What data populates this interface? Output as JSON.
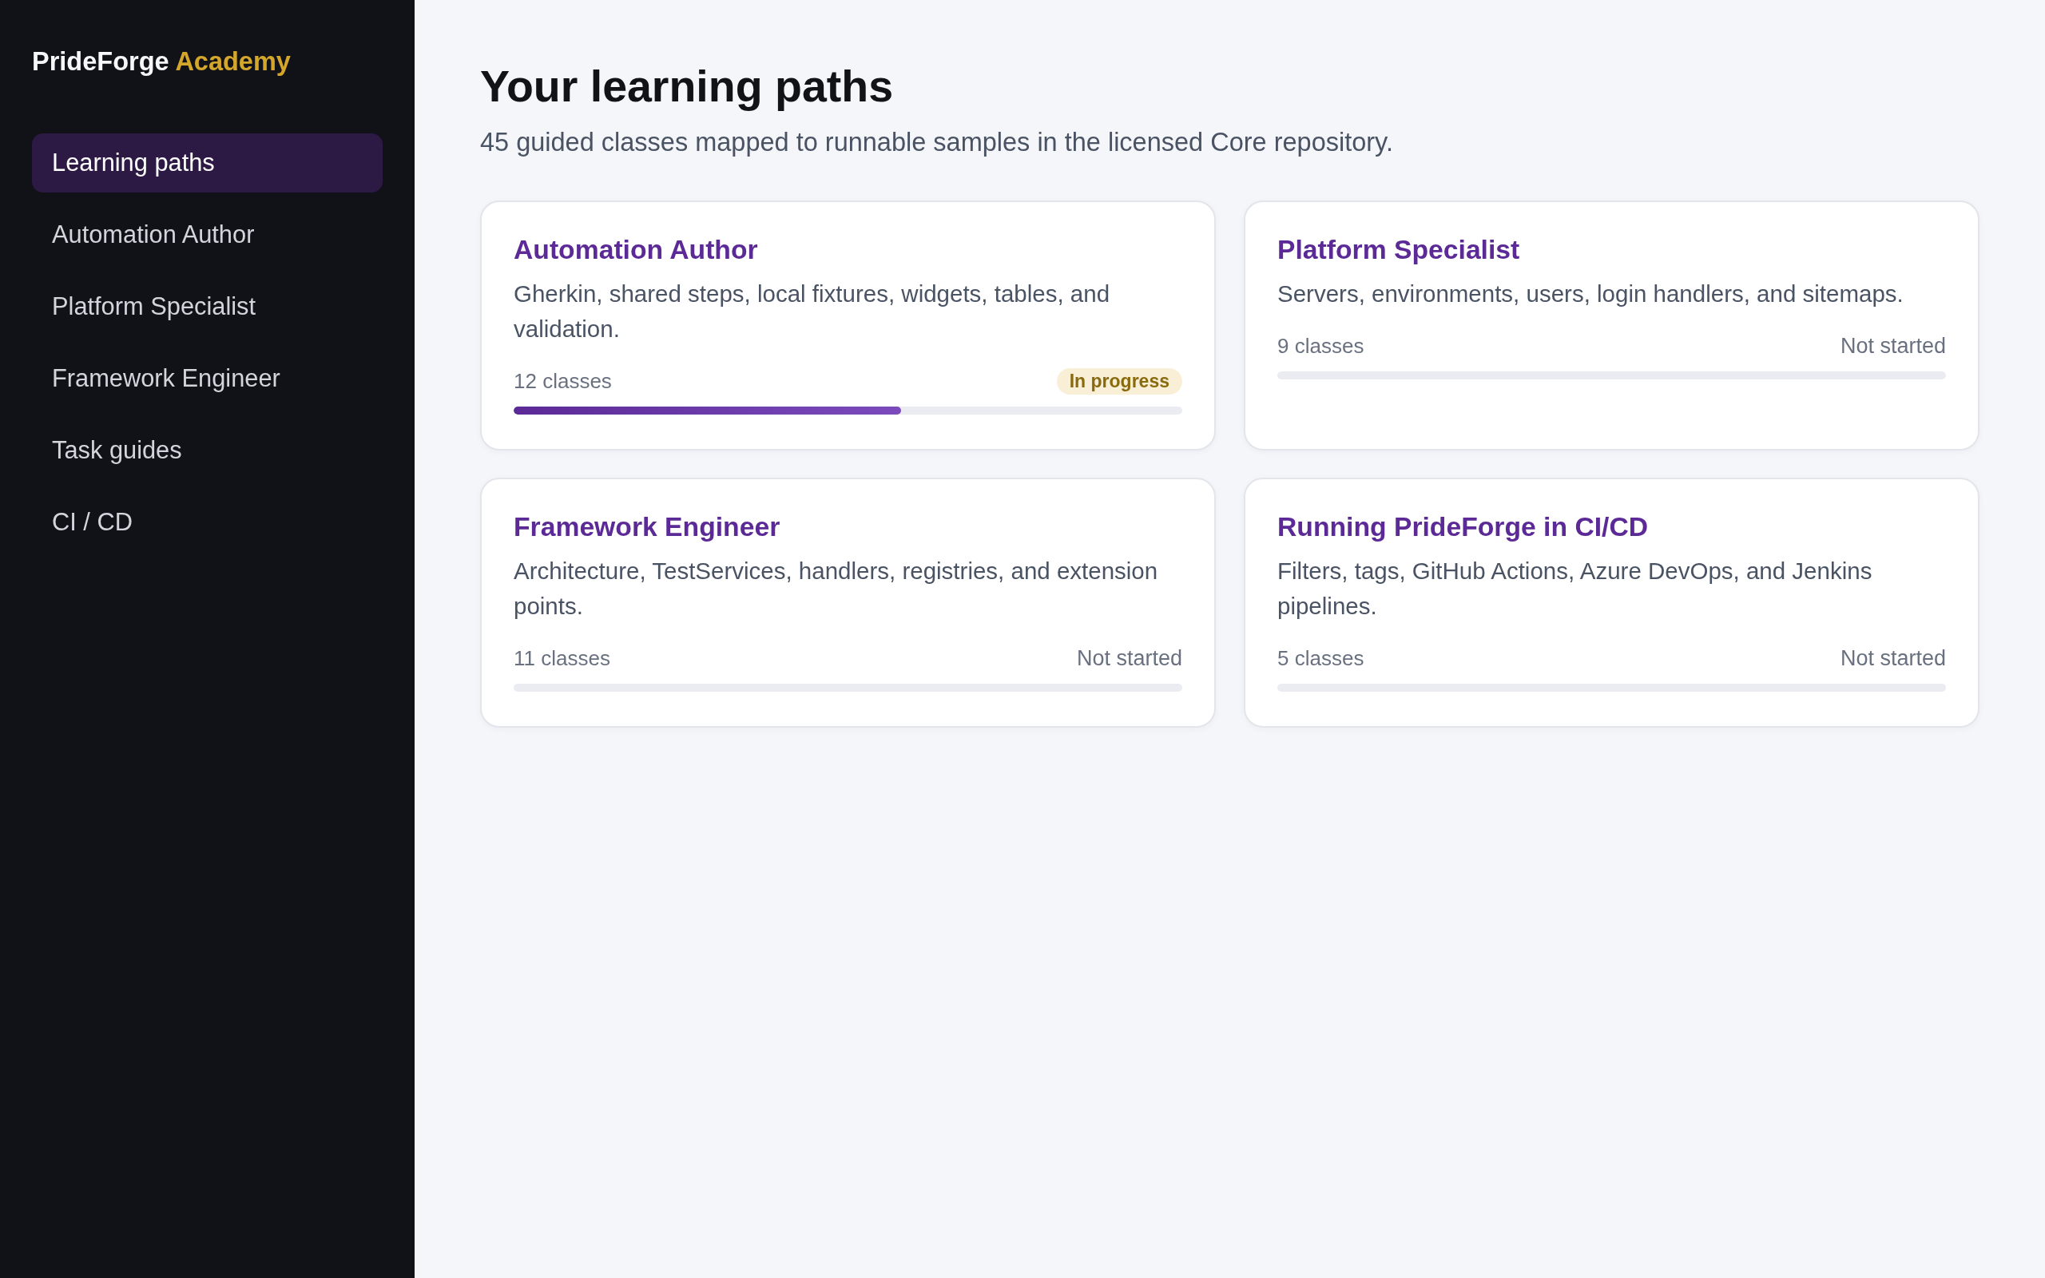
{
  "sidebar": {
    "brand": {
      "name": "PrideForge",
      "accent": "Academy"
    },
    "items": [
      {
        "label": "Learning paths",
        "selected": true
      },
      {
        "label": "Automation Author",
        "selected": false
      },
      {
        "label": "Platform Specialist",
        "selected": false
      },
      {
        "label": "Framework Engineer",
        "selected": false
      },
      {
        "label": "Task guides",
        "selected": false
      },
      {
        "label": "CI / CD",
        "selected": false
      }
    ]
  },
  "header": {
    "title": "Your learning paths",
    "subtitle": "45 guided classes mapped to runnable samples in the licensed Core repository."
  },
  "paths": [
    {
      "title": "Automation Author",
      "description": "Gherkin, shared steps, local fixtures, widgets, tables, and validation.",
      "classes": "12 classes",
      "status": {
        "label": "In progress",
        "kind": "in_progress"
      },
      "level": 0.58
    },
    {
      "title": "Platform Specialist",
      "description": "Servers, environments, users, login handlers, and sitemaps.",
      "classes": "9 classes",
      "status": {
        "label": "Not started",
        "kind": "not_started"
      }
    },
    {
      "title": "Framework Engineer",
      "description": "Architecture, TestServices, handlers, registries, and extension points.",
      "classes": "11 classes",
      "status": {
        "label": "Not started",
        "kind": "not_started"
      }
    },
    {
      "title": "Running PrideForge in CI/CD",
      "description": "Filters, tags, GitHub Actions, Azure DevOps, and Jenkins pipelines.",
      "classes": "5 classes",
      "status": {
        "label": "Not started",
        "kind": "not_started"
      }
    }
  ]
}
